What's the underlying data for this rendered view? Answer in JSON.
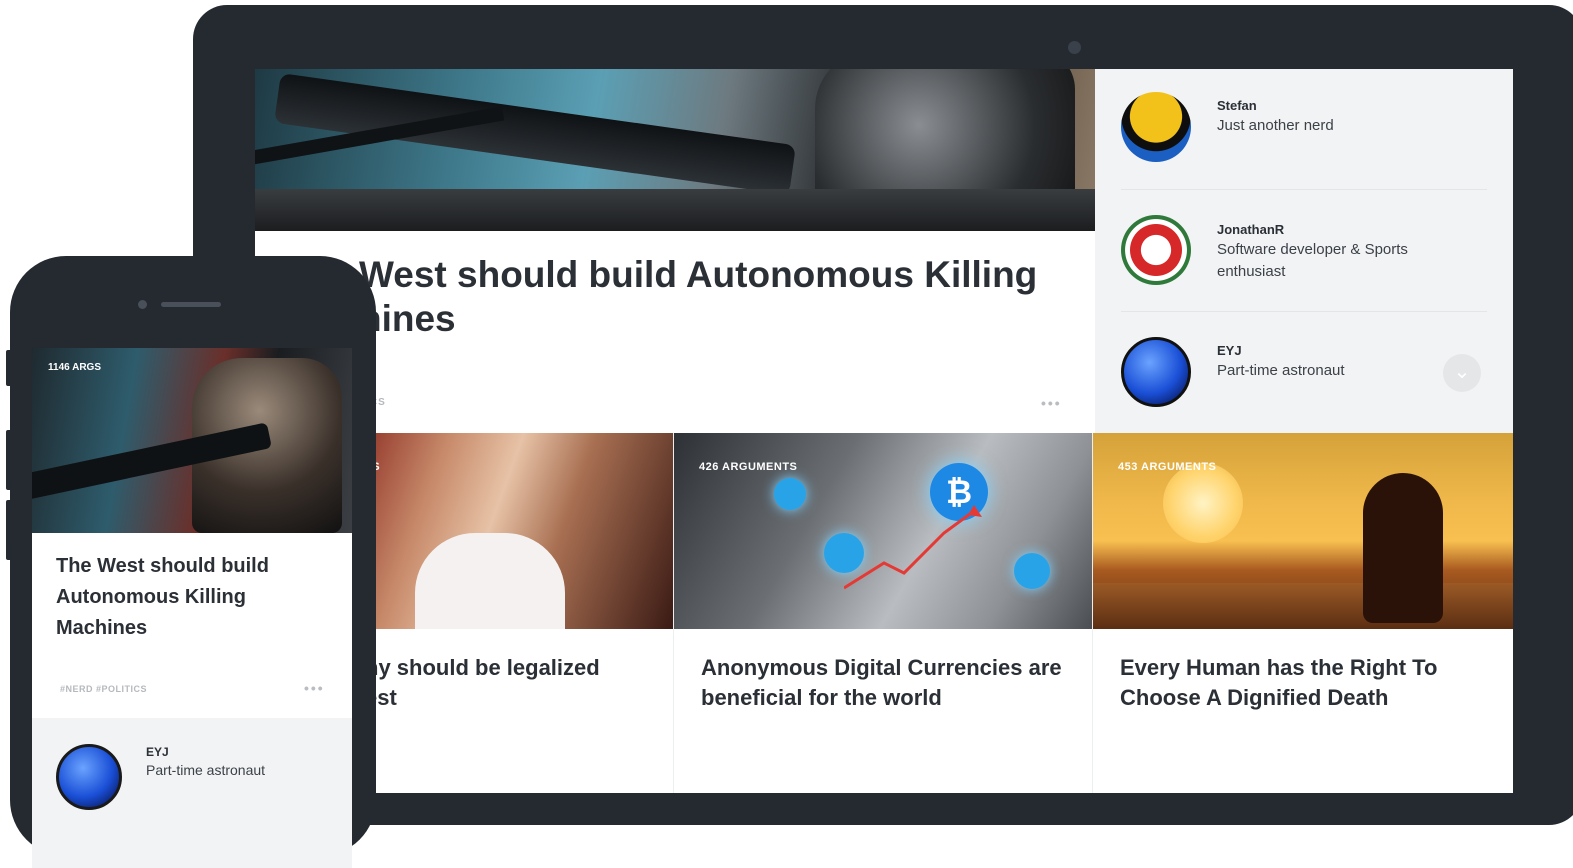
{
  "laptop": {
    "hero": {
      "title": "West should build Autonomous Killing\nhines",
      "tags": "TICS"
    },
    "sidebar": {
      "users": [
        {
          "name": "Stefan",
          "bio": "Just another nerd",
          "avatar": "lego-avatar"
        },
        {
          "name": "JonathanR",
          "bio": "Software developer & Sports enthusiast",
          "avatar": "logo-avatar"
        },
        {
          "name": "EYJ",
          "bio": "Part-time astronaut",
          "avatar": "planet-avatar"
        }
      ],
      "follow_icon": "chevron-down-icon"
    },
    "cards": [
      {
        "count": "TS",
        "title": "ny should be legalized\nest"
      },
      {
        "count": "426 ARGUMENTS",
        "title": "Anonymous Digital Currencies are beneficial for the world"
      },
      {
        "count": "453 ARGUMENTS",
        "title": "Every Human has the Right To Choose A Dignified Death"
      }
    ]
  },
  "phone": {
    "args": "1146 ARGS",
    "title": "The West should build Autonomous Killing Machines",
    "tags": "#NERD  #POLITICS",
    "user": {
      "name": "EYJ",
      "bio": "Part-time astronaut"
    }
  },
  "more_label": "•••"
}
